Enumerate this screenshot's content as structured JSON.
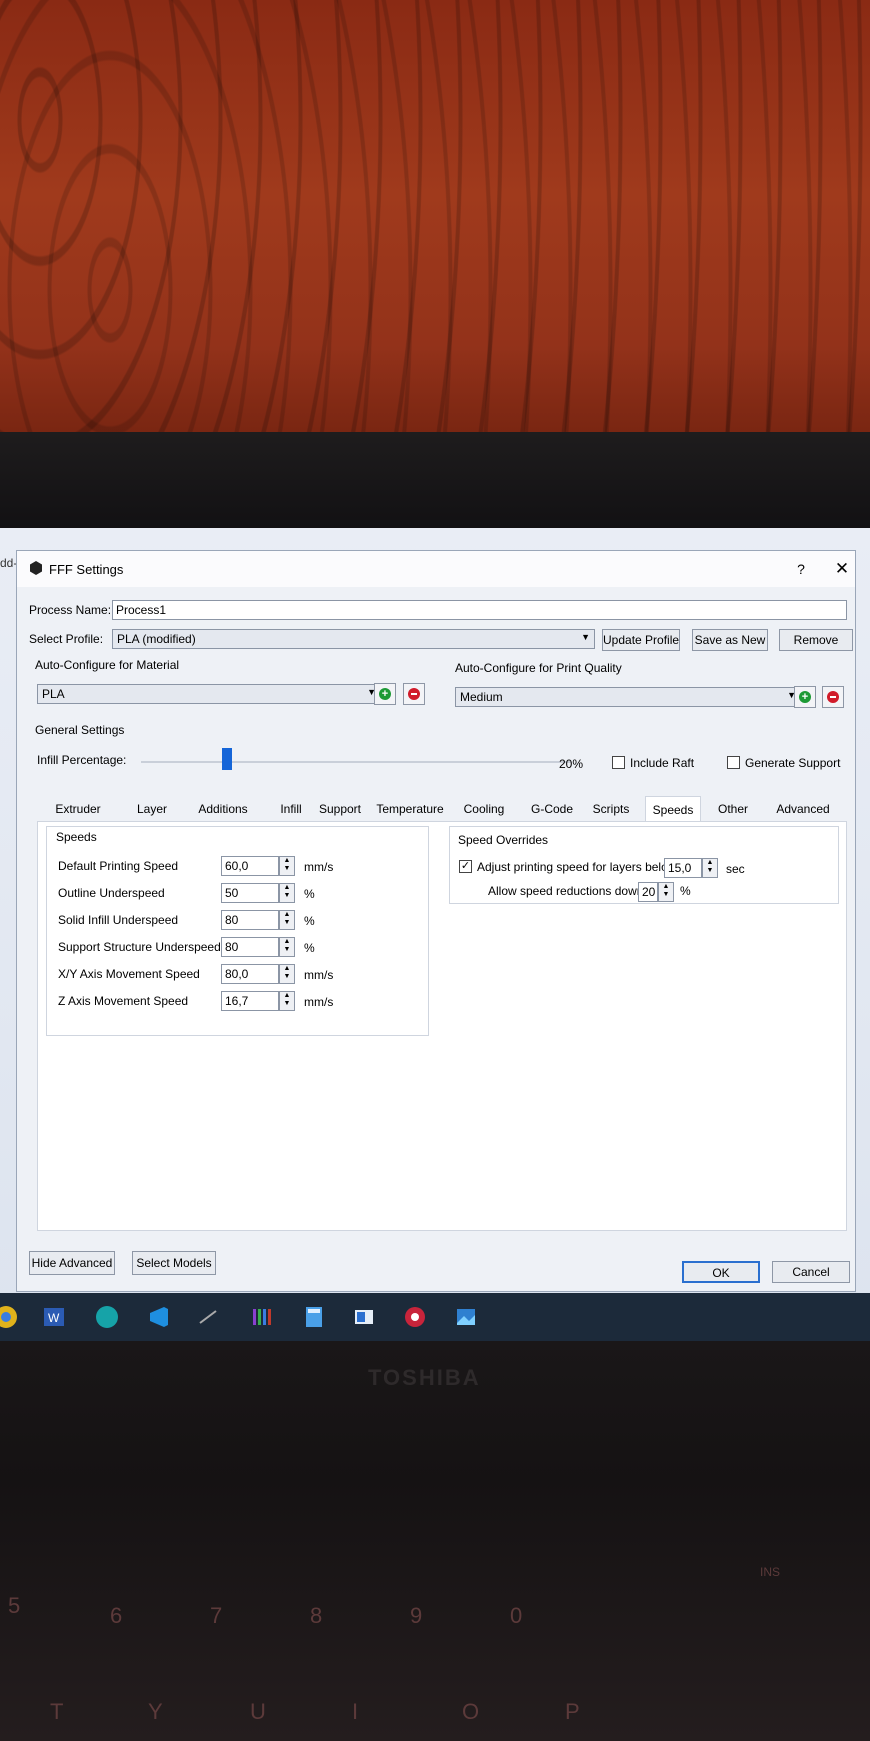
{
  "background": {
    "left_edge_text": "dd-",
    "brand": "TOSHIBA",
    "keys": [
      "5",
      "6",
      "7",
      "8",
      "9",
      "0",
      "INS",
      "T",
      "Y",
      "U",
      "I",
      "O",
      "P"
    ]
  },
  "dialog": {
    "title": "FFF Settings",
    "help": "?",
    "close": "✕",
    "process_name_label": "Process Name:",
    "process_name_value": "Process1",
    "select_profile_label": "Select Profile:",
    "select_profile_value": "PLA (modified)",
    "update_profile": "Update Profile",
    "save_as_new": "Save as New",
    "remove": "Remove",
    "material_label": "Auto-Configure for Material",
    "material_value": "PLA",
    "quality_label": "Auto-Configure for Print Quality",
    "quality_value": "Medium",
    "general_settings": "General Settings",
    "infill_label": "Infill Percentage:",
    "infill_value": "20%",
    "infill_fraction": 0.2,
    "include_raft": "Include Raft",
    "generate_support": "Generate Support",
    "tabs": [
      "Extruder",
      "Layer",
      "Additions",
      "Infill",
      "Support",
      "Temperature",
      "Cooling",
      "G-Code",
      "Scripts",
      "Speeds",
      "Other",
      "Advanced"
    ],
    "active_tab": "Speeds",
    "speeds": {
      "group_title": "Speeds",
      "rows": [
        {
          "label": "Default Printing Speed",
          "value": "60,0",
          "unit": "mm/s"
        },
        {
          "label": "Outline Underspeed",
          "value": "50",
          "unit": "%"
        },
        {
          "label": "Solid Infill Underspeed",
          "value": "80",
          "unit": "%"
        },
        {
          "label": "Support Structure Underspeed",
          "value": "80",
          "unit": "%"
        },
        {
          "label": "X/Y Axis Movement Speed",
          "value": "80,0",
          "unit": "mm/s"
        },
        {
          "label": "Z Axis Movement Speed",
          "value": "16,7",
          "unit": "mm/s"
        }
      ]
    },
    "overrides": {
      "group_title": "Speed Overrides",
      "adjust_label": "Adjust printing speed for layers below",
      "adjust_checked": "✓",
      "adjust_value": "15,0",
      "adjust_unit": "sec",
      "allow_label": "Allow speed reductions down to",
      "allow_value": "20",
      "allow_unit": "%"
    },
    "hide_advanced": "Hide Advanced",
    "select_models": "Select Models",
    "ok": "OK",
    "cancel": "Cancel"
  },
  "taskbar": {
    "icons": [
      "chrome-icon",
      "word-icon",
      "arduino-icon",
      "vscode-icon",
      "app-icon",
      "simplify3d-icon",
      "calculator-icon",
      "window-icon",
      "settings-icon",
      "photos-icon"
    ]
  }
}
